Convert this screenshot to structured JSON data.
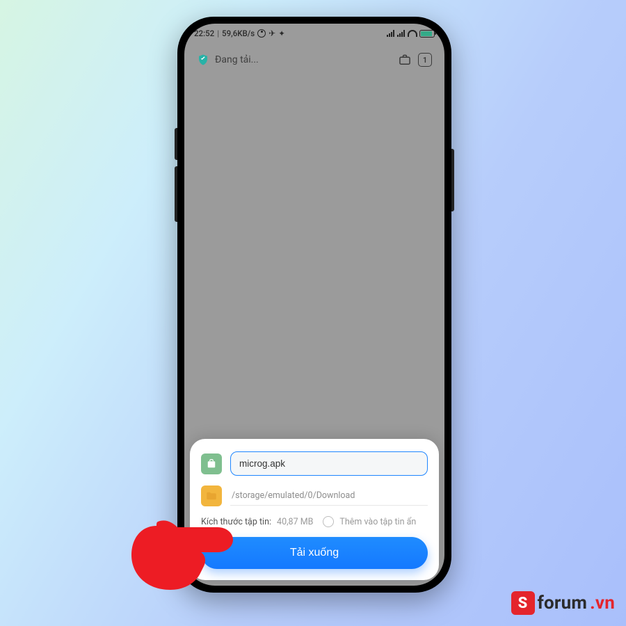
{
  "statusbar": {
    "time": "22:52",
    "speed": "59,6KB/s"
  },
  "browser": {
    "loading_text": "Đang tải...",
    "tab_count": "1"
  },
  "download_dialog": {
    "filename": "microg.apk",
    "path": "/storage/emulated/0/Download",
    "size_label": "Kích thước tập tin:",
    "size_value": "40,87 MB",
    "hidden_label": "Thêm vào tập tin ẩn",
    "button": "Tải xuống"
  },
  "watermark": {
    "badge": "S",
    "text": "forum",
    "domain": ".vn"
  }
}
